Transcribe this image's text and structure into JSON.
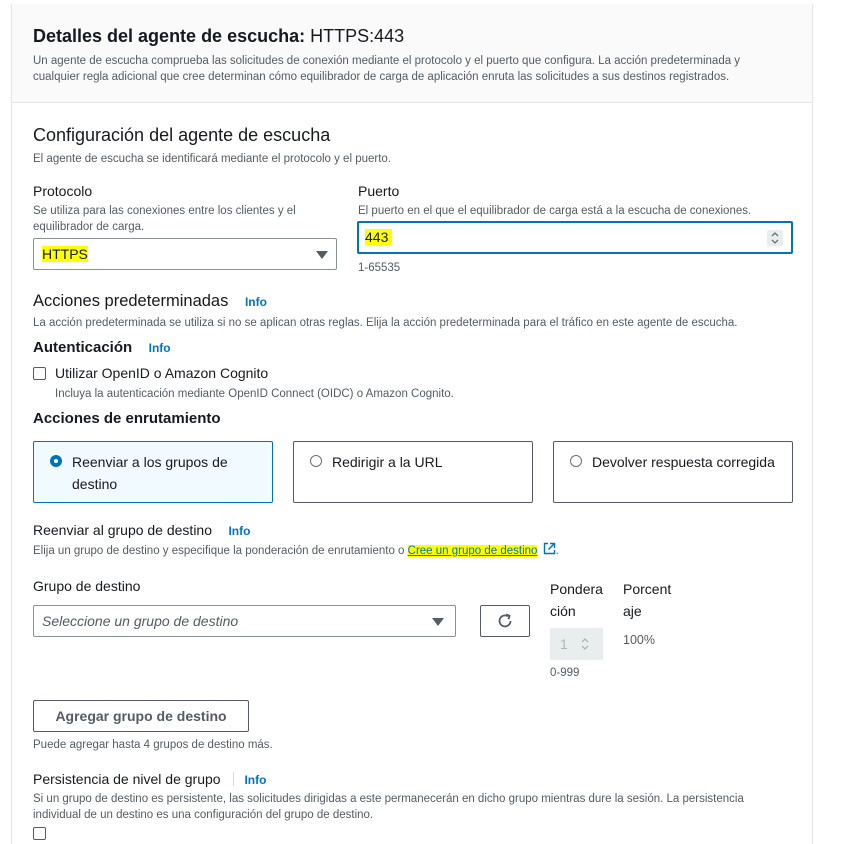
{
  "header": {
    "title_bold": "Detalles del agente de escucha:",
    "title_value": "HTTPS:443",
    "description_line1": "Un agente de escucha comprueba las solicitudes de conexión mediante el protocolo y el puerto que configura. La acción predeterminada y",
    "description_line2": "cualquier regla adicional que cree determinan cómo equilibrador de carga de aplicación enruta las solicitudes a sus destinos registrados."
  },
  "config": {
    "title": "Configuración del agente de escucha",
    "description": "El agente de escucha se identificará mediante el protocolo y el puerto.",
    "protocol_label": "Protocolo",
    "protocol_desc_line1": "Se utiliza para las conexiones entre los clientes y el",
    "protocol_desc_line2": "equilibrador de carga.",
    "protocol_value": "HTTPS",
    "port_label": "Puerto",
    "port_desc": "El puerto en el que el equilibrador de carga está a la escucha de conexiones.",
    "port_value": "443",
    "port_hint": "1-65535"
  },
  "default_actions": {
    "title": "Acciones predeterminadas",
    "info": "Info",
    "description": "La acción predeterminada se utiliza si no se aplican otras reglas. Elija la acción predeterminada para el tráfico en este agente de escucha."
  },
  "auth": {
    "title": "Autenticación",
    "info": "Info",
    "checkbox_label": "Utilizar OpenID o Amazon Cognito",
    "checkbox_desc": "Incluya la autenticación mediante OpenID Connect (OIDC) o Amazon Cognito."
  },
  "routing": {
    "title": "Acciones de enrutamiento",
    "options": [
      {
        "line1": "Reenviar a los grupos de",
        "line2": "destino",
        "selected": true
      },
      {
        "line1": "Redirigir a la URL",
        "line2": "",
        "selected": false
      },
      {
        "line1": "Devolver respuesta corregida",
        "line2": "",
        "selected": false
      }
    ]
  },
  "forward": {
    "title": "Reenviar al grupo de destino",
    "info": "Info",
    "desc_prefix": "Elija un grupo de destino y especifique la ponderación de enrutamiento o ",
    "desc_link": "Cree un grupo de destino",
    "desc_suffix": ".",
    "target_group_label": "Grupo de destino",
    "target_group_placeholder": "Seleccione un grupo de destino",
    "weight_label_line1": "Pondera",
    "weight_label_line2": "ción",
    "weight_value": "1",
    "weight_hint": "0-999",
    "percent_label_line1": "Porcent",
    "percent_label_line2": "aje",
    "percent_value": "100%",
    "add_button": "Agregar grupo de destino",
    "add_hint": "Puede agregar hasta 4 grupos de destino más."
  },
  "stickiness": {
    "title": "Persistencia de nivel de grupo",
    "info": "Info",
    "desc_line1": "Si un grupo de destino es persistente, las solicitudes dirigidas a este permanecerán en dicho grupo mientras dure la sesión. La persistencia",
    "desc_line2": "individual de un destino es una configuración del grupo de destino."
  },
  "colors": {
    "accent": "#0073bb",
    "highlight": "#ffff00",
    "text": "#16191f",
    "muted": "#545b64"
  },
  "icons": [
    "dropdown-caret-icon",
    "stepper-icon",
    "refresh-icon",
    "external-link-icon",
    "radio-icon",
    "checkbox-icon"
  ]
}
